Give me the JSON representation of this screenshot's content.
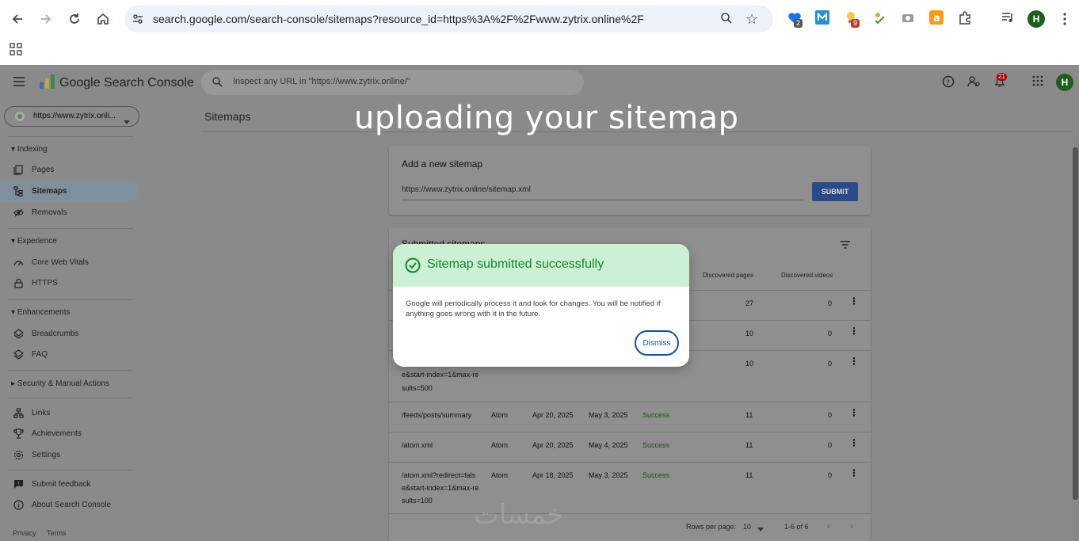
{
  "browser": {
    "url": "search.google.com/search-console/sitemaps?resource_id=https%3A%2F%2Fwww.zytrix.online%2F",
    "extension_badges": [
      "2",
      "9"
    ],
    "profile_initial": "H"
  },
  "app": {
    "logo_text": "Google Search Console",
    "search_placeholder": "Inspect any URL in \"https://www.zytrix.online/\"",
    "notification_count": "21",
    "profile_initial": "H"
  },
  "sidebar": {
    "property": "https://www.zytrix.onli...",
    "sections": {
      "indexing": "Indexing",
      "experience": "Experience",
      "enhancements": "Enhancements",
      "security": "Security & Manual Actions"
    },
    "items": {
      "pages": "Pages",
      "sitemaps": "Sitemaps",
      "removals": "Removals",
      "cwv": "Core Web Vitals",
      "https": "HTTPS",
      "breadcrumbs": "Breadcrumbs",
      "faq": "FAQ",
      "links": "Links",
      "achievements": "Achievements",
      "settings": "Settings",
      "feedback": "Submit feedback",
      "about": "About Search Console"
    },
    "footer": {
      "privacy": "Privacy",
      "terms": "Terms"
    }
  },
  "main": {
    "page_title": "Sitemaps",
    "add_card": {
      "title": "Add a new sitemap",
      "input_value": "https://www.zytrix.online/sitemap.xml",
      "submit_label": "SUBMIT"
    },
    "submitted_card": {
      "title": "Submitted sitemaps",
      "columns": {
        "discovered_pages": "Discovered pages",
        "discovered_videos": "Discovered videos"
      },
      "rows": [
        {
          "pages": "27",
          "videos": "0"
        },
        {
          "pages": "10",
          "videos": "0"
        },
        {
          "sitemap_tail": "e&start-index=1&max-re",
          "sitemap_tail2": "sults=500",
          "pages": "10",
          "videos": "0"
        },
        {
          "sitemap": "/feeds/posts/summary",
          "type": "Atom",
          "submitted": "Apr 20, 2025",
          "last_read": "May 3, 2025",
          "status": "Success",
          "pages": "11",
          "videos": "0"
        },
        {
          "sitemap": "/atom.xml",
          "type": "Atom",
          "submitted": "Apr 20, 2025",
          "last_read": "May 4, 2025",
          "status": "Success",
          "pages": "11",
          "videos": "0"
        },
        {
          "sitemap": "/atom.xml?redirect=fals",
          "sitemap2": "e&start-index=1&max-re",
          "sitemap3": "sults=100",
          "type": "Atom",
          "submitted": "Apr 18, 2025",
          "last_read": "May 3, 2025",
          "status": "Success",
          "pages": "11",
          "videos": "0"
        }
      ],
      "pagination": {
        "rows_per_page_label": "Rows per page:",
        "rows_per_page": "10",
        "range": "1-6 of 6"
      }
    }
  },
  "overlay_caption": "uploading your sitemap",
  "watermark": "خمسات",
  "dialog": {
    "title": "Sitemap submitted successfully",
    "body": "Google will periodically process it and look for changes. You will be notified if anything goes wrong with it in the future.",
    "dismiss_label": "Dismiss"
  },
  "colors": {
    "success_green": "#188038",
    "dialog_header": "#ccf0d4",
    "submit_blue": "#1a73e8"
  }
}
